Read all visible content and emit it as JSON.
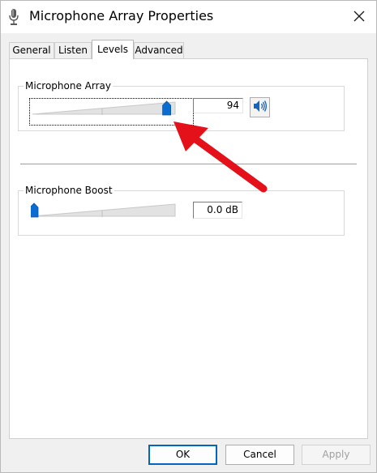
{
  "window": {
    "title": "Microphone Array Properties"
  },
  "tabs": [
    {
      "label": "General",
      "active": false
    },
    {
      "label": "Listen",
      "active": false
    },
    {
      "label": "Levels",
      "active": true
    },
    {
      "label": "Advanced",
      "active": false
    }
  ],
  "levels": {
    "microphone_array": {
      "label": "Microphone Array",
      "value": "94",
      "level_percent": 94,
      "speaker_icon": "speaker-volume-icon"
    },
    "microphone_boost": {
      "label": "Microphone Boost",
      "value": "0.0 dB",
      "level_percent": 0
    }
  },
  "buttons": {
    "ok": "OK",
    "cancel": "Cancel",
    "apply": "Apply"
  },
  "colors": {
    "accent": "#0067c0",
    "slider_thumb": "#0a6cd0",
    "annotation_arrow": "#e4101a"
  }
}
